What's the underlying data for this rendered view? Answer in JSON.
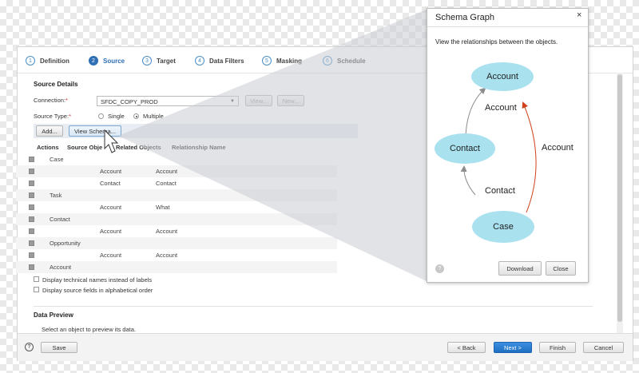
{
  "wizard": {
    "steps": [
      {
        "num": "1",
        "label": "Definition"
      },
      {
        "num": "2",
        "label": "Source"
      },
      {
        "num": "3",
        "label": "Target"
      },
      {
        "num": "4",
        "label": "Data Filters"
      },
      {
        "num": "5",
        "label": "Masking"
      },
      {
        "num": "6",
        "label": "Schedule"
      }
    ]
  },
  "source": {
    "section_title": "Source Details",
    "connection_label": "Connection:",
    "required_mark": "*",
    "connection_value": "SFDC_COPY_PROD",
    "view_button": "View...",
    "new_button": "New...",
    "source_type_label": "Source Type:",
    "source_type_options": [
      "Single",
      "Multiple"
    ],
    "source_type_selected": "Multiple",
    "add_button": "Add...",
    "view_schema_button": "View Schema..."
  },
  "table": {
    "headers": [
      "Actions",
      "Source Obje",
      "Related Objects",
      "Relationship Name"
    ],
    "rows": [
      {
        "source": "Case",
        "related": "",
        "relationship": ""
      },
      {
        "source": "",
        "related": "Account",
        "relationship": "Account"
      },
      {
        "source": "",
        "related": "Contact",
        "relationship": "Contact"
      },
      {
        "source": "Task",
        "related": "",
        "relationship": ""
      },
      {
        "source": "",
        "related": "Account",
        "relationship": "What"
      },
      {
        "source": "Contact",
        "related": "",
        "relationship": ""
      },
      {
        "source": "",
        "related": "Account",
        "relationship": "Account"
      },
      {
        "source": "Opportunity",
        "related": "",
        "relationship": ""
      },
      {
        "source": "",
        "related": "Account",
        "relationship": "Account"
      },
      {
        "source": "Account",
        "related": "",
        "relationship": ""
      }
    ]
  },
  "options": {
    "technical_names": "Display technical names instead of labels",
    "alphabetical": "Display source fields in alphabetical order"
  },
  "preview": {
    "title": "Data Preview",
    "hint": "Select an object to preview its data."
  },
  "footer": {
    "help": "?",
    "save": "Save",
    "back": "< Back",
    "next": "Next >",
    "finish": "Finish",
    "cancel": "Cancel"
  },
  "dialog": {
    "title": "Schema Graph",
    "close": "×",
    "description": "View the relationships between the objects.",
    "nodes": {
      "account": "Account",
      "contact": "Contact",
      "case": "Case"
    },
    "edges": {
      "contact_to_account": "Account",
      "case_to_account": "Account",
      "case_to_contact": "Contact"
    },
    "help": "?",
    "download_button": "Download",
    "close_button": "Close",
    "colors": {
      "node": "#a9e1ef",
      "edge_gray": "#8c8c8c",
      "edge_red": "#d0421b"
    }
  }
}
